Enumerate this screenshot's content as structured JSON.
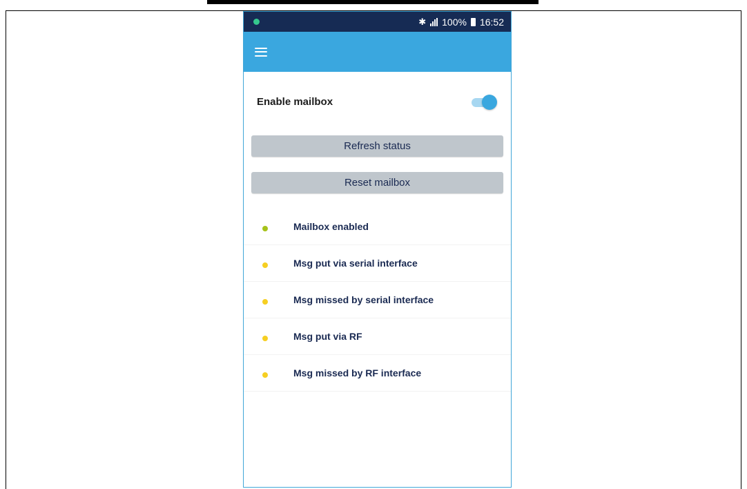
{
  "statusbar": {
    "battery_text": "100%",
    "time": "16:52",
    "bluetooth_glyph": "✱"
  },
  "settings": {
    "enable_mailbox_label": "Enable mailbox",
    "enable_mailbox_on": true
  },
  "buttons": {
    "refresh_label": "Refresh status",
    "reset_label": "Reset mailbox"
  },
  "status_items": [
    {
      "label": "Mailbox enabled",
      "color": "#a6c21a"
    },
    {
      "label": "Msg put via serial interface",
      "color": "#f6cf22"
    },
    {
      "label": "Msg missed by serial interface",
      "color": "#f6cf22"
    },
    {
      "label": "Msg put via RF",
      "color": "#f6cf22"
    },
    {
      "label": "Msg missed by RF interface",
      "color": "#f6cf22"
    }
  ],
  "colors": {
    "statusbar_bg": "#162b54",
    "appbar_bg": "#3aa7df",
    "button_bg": "#bfc6cc",
    "led_green": "#a6c21a",
    "led_yellow": "#f6cf22"
  }
}
